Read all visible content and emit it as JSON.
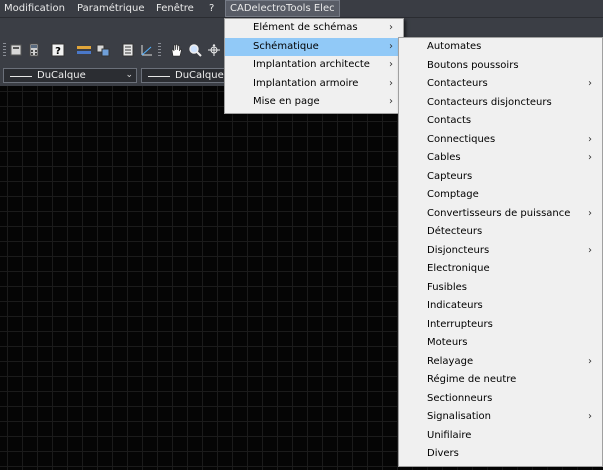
{
  "menubar": {
    "items": [
      {
        "label": "Modification"
      },
      {
        "label": "Paramétrique"
      },
      {
        "label": "Fenêtre"
      },
      {
        "label": "?"
      },
      {
        "label": "CADelectroTools Elec"
      }
    ]
  },
  "toolbar": {
    "icons": [
      "calculator-icon",
      "help-icon",
      "layer-icon",
      "match-properties-icon",
      "properties-icon",
      "palette-icon",
      "pan-icon",
      "zoom-icon",
      "orbit-icon"
    ],
    "layer_combo_value": "DuCalque",
    "linetype_combo_value": "DuCalque"
  },
  "main_menu": {
    "items": [
      {
        "label": "Elément de schémas",
        "submenu": true
      },
      {
        "label": "Schématique",
        "submenu": true,
        "highlighted": true
      },
      {
        "label": "Implantation architecte",
        "submenu": true
      },
      {
        "label": "Implantation armoire",
        "submenu": true
      },
      {
        "label": "Mise en page",
        "submenu": true
      }
    ]
  },
  "sub_menu": {
    "items": [
      {
        "label": "Automates",
        "submenu": false
      },
      {
        "label": "Boutons poussoirs",
        "submenu": false
      },
      {
        "label": "Contacteurs",
        "submenu": true
      },
      {
        "label": "Contacteurs disjoncteurs",
        "submenu": false
      },
      {
        "label": "Contacts",
        "submenu": false
      },
      {
        "label": "Connectiques",
        "submenu": true
      },
      {
        "label": "Cables",
        "submenu": true
      },
      {
        "label": "Capteurs",
        "submenu": false
      },
      {
        "label": "Comptage",
        "submenu": false
      },
      {
        "label": "Convertisseurs de puissance",
        "submenu": true
      },
      {
        "label": "Détecteurs",
        "submenu": false
      },
      {
        "label": "Disjoncteurs",
        "submenu": true
      },
      {
        "label": "Electronique",
        "submenu": false
      },
      {
        "label": "Fusibles",
        "submenu": false
      },
      {
        "label": "Indicateurs",
        "submenu": false
      },
      {
        "label": "Interrupteurs",
        "submenu": false
      },
      {
        "label": "Moteurs",
        "submenu": false
      },
      {
        "label": "Relayage",
        "submenu": true
      },
      {
        "label": "Régime de neutre",
        "submenu": false
      },
      {
        "label": "Sectionneurs",
        "submenu": false
      },
      {
        "label": "Signalisation",
        "submenu": true
      },
      {
        "label": "Unifilaire",
        "submenu": false
      },
      {
        "label": "Divers",
        "submenu": false
      }
    ]
  },
  "colors": {
    "menubar_bg": "#3a3d44",
    "menu_bg": "#f0f0f0",
    "highlight": "#91c9f7",
    "canvas_bg": "#050505"
  }
}
